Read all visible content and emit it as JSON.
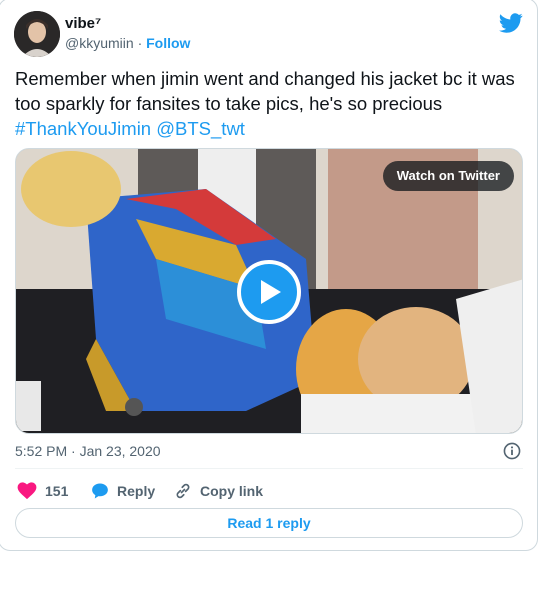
{
  "author": {
    "name": "vibe⁷",
    "handle": "@kkyumiin",
    "separator": "·",
    "follow_label": "Follow"
  },
  "tweet": {
    "text_plain": "Remember when jimin went and changed his jacket bc it was too sparkly for fansites to take pics, he's so precious",
    "hashtag": "#ThankYouJimin",
    "mention": "@BTS_twt"
  },
  "media": {
    "watch_label": "Watch on Twitter"
  },
  "meta": {
    "time": "5:52 PM · Jan 23, 2020"
  },
  "actions": {
    "likes": "151",
    "reply_label": "Reply",
    "copy_link_label": "Copy link"
  },
  "read_reply_label": "Read 1 reply",
  "colors": {
    "brand": "#1d9bf0",
    "like": "#f91880",
    "muted": "#536471"
  },
  "icons": [
    "twitter-bird-icon",
    "play-icon",
    "info-icon",
    "heart-icon",
    "reply-bubble-icon",
    "link-icon"
  ]
}
